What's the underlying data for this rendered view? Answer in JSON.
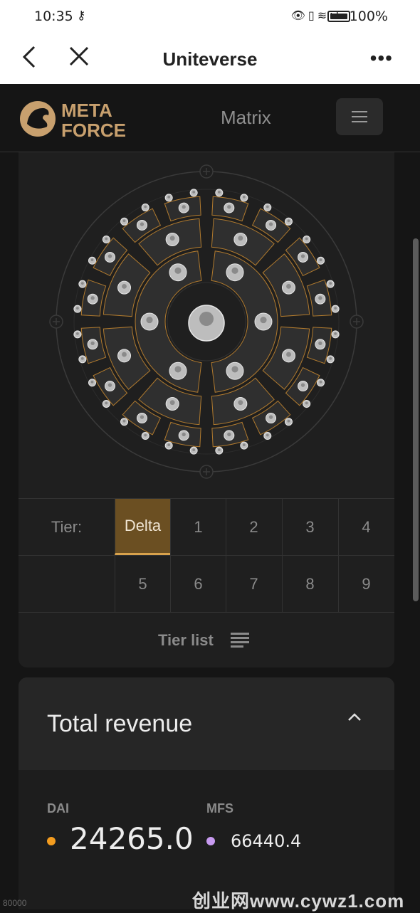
{
  "status_bar": {
    "time": "10:35",
    "battery": "100%"
  },
  "browser": {
    "title": "Uniteverse"
  },
  "header": {
    "logo_text_1": "META",
    "logo_text_2": "FORCE",
    "section": "Matrix"
  },
  "tiers": {
    "label": "Tier:",
    "row1": [
      "Delta",
      "1",
      "2",
      "3",
      "4"
    ],
    "row2": [
      "5",
      "6",
      "7",
      "8",
      "9"
    ],
    "active": "Delta",
    "list_label": "Tier list"
  },
  "revenue": {
    "title": "Total revenue",
    "currencies": [
      {
        "name": "DAI",
        "value": "24265.0",
        "color": "#f39c1f"
      },
      {
        "name": "MFS",
        "value": "66440.4",
        "color": "#c79af0"
      }
    ]
  },
  "footer": {
    "clipped_text": "80000",
    "watermark": "创业网www.cywz1.com"
  },
  "colors": {
    "accent": "#d8a24c",
    "active_bg": "#6b4f22"
  }
}
